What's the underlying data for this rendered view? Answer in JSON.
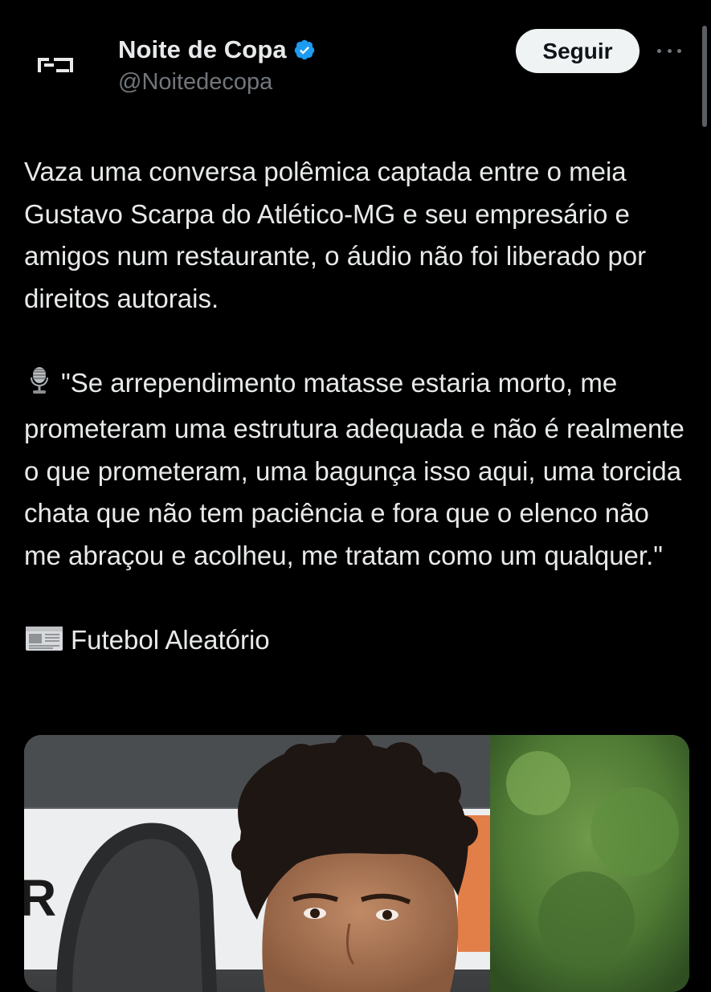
{
  "author": {
    "display_name": "Noite de Copa",
    "handle": "@Noitedecopa",
    "avatar_icon": "noite-de-copa-logo",
    "verified": true,
    "verified_color": "#1d9bf0"
  },
  "actions": {
    "follow_label": "Seguir",
    "more_icon": "more-horizontal-icon"
  },
  "tweet": {
    "paragraphs": [
      "Vaza uma conversa polêmica captada entre o meia Gustavo Scarpa do Atlético-MG e seu empresário e amigos num restaurante, o áudio não foi liberado por direitos autorais.",
      "\"Se arrependimento matasse estaria morto, me prometeram uma estrutura adequada e não é realmente o que prometeram, uma bagunça isso aqui, uma torcida chata que não tem paciência e fora que o elenco não me abraçou e acolheu, me tratam como um qualquer.\"",
      "Futebol Aleatório"
    ],
    "quote_emoji_icon": "microphone-icon",
    "source_emoji_icon": "newspaper-icon"
  },
  "media": {
    "type": "photo",
    "icon": "player-photo"
  },
  "colors": {
    "background": "#000000",
    "text": "#e7e9ea",
    "secondary_text": "#71767b",
    "follow_button_bg": "#eff3f4"
  }
}
